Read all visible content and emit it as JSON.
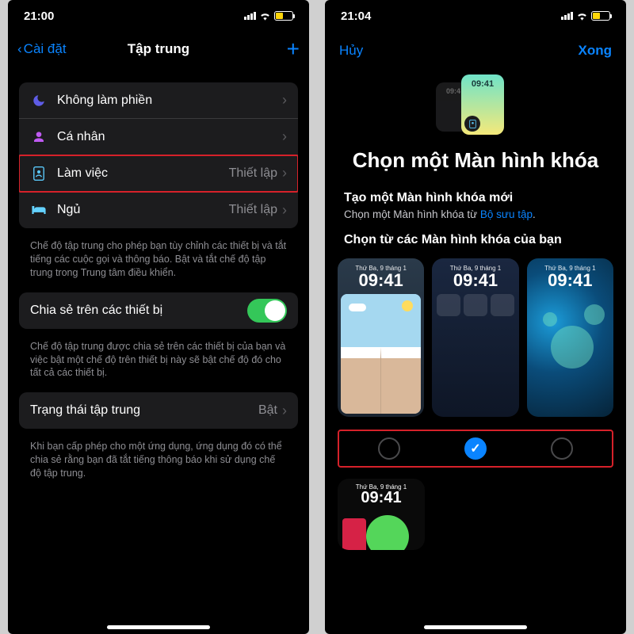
{
  "left": {
    "status_time": "21:00",
    "back_label": "Cài đặt",
    "title": "Tập trung",
    "rows": [
      {
        "label": "Không làm phiền",
        "detail": ""
      },
      {
        "label": "Cá nhân",
        "detail": ""
      },
      {
        "label": "Làm việc",
        "detail": "Thiết lập"
      },
      {
        "label": "Ngủ",
        "detail": "Thiết lập"
      }
    ],
    "footer1": "Chế độ tập trung cho phép bạn tùy chỉnh các thiết bị và tắt tiếng các cuộc gọi và thông báo. Bật và tắt chế độ tập trung trong Trung tâm điều khiển.",
    "share_label": "Chia sẻ trên các thiết bị",
    "footer2": "Chế độ tập trung được chia sẻ trên các thiết bị của bạn và việc bật một chế độ trên thiết bị này sẽ bật chế độ đó cho tất cả các thiết bị.",
    "status_label": "Trạng thái tập trung",
    "status_value": "Bật",
    "footer3": "Khi bạn cấp phép cho một ứng dụng, ứng dụng đó có thể chia sẻ rằng bạn đã tắt tiếng thông báo khi sử dụng chế độ tập trung."
  },
  "right": {
    "status_time": "21:04",
    "cancel": "Hủy",
    "done": "Xong",
    "mini_time": "09:41",
    "mini_time_back": "09:4",
    "big_title": "Chọn một Màn hình khóa",
    "create_title": "Tạo một Màn hình khóa mới",
    "create_sub_a": "Chọn một Màn hình khóa từ ",
    "create_sub_link": "Bộ sưu tập",
    "create_sub_b": ".",
    "choose_title": "Chọn từ các Màn hình khóa của bạn",
    "thumb_day": "Thứ Ba, 9 tháng 1",
    "thumb_time": "09:41",
    "check": "✓"
  }
}
